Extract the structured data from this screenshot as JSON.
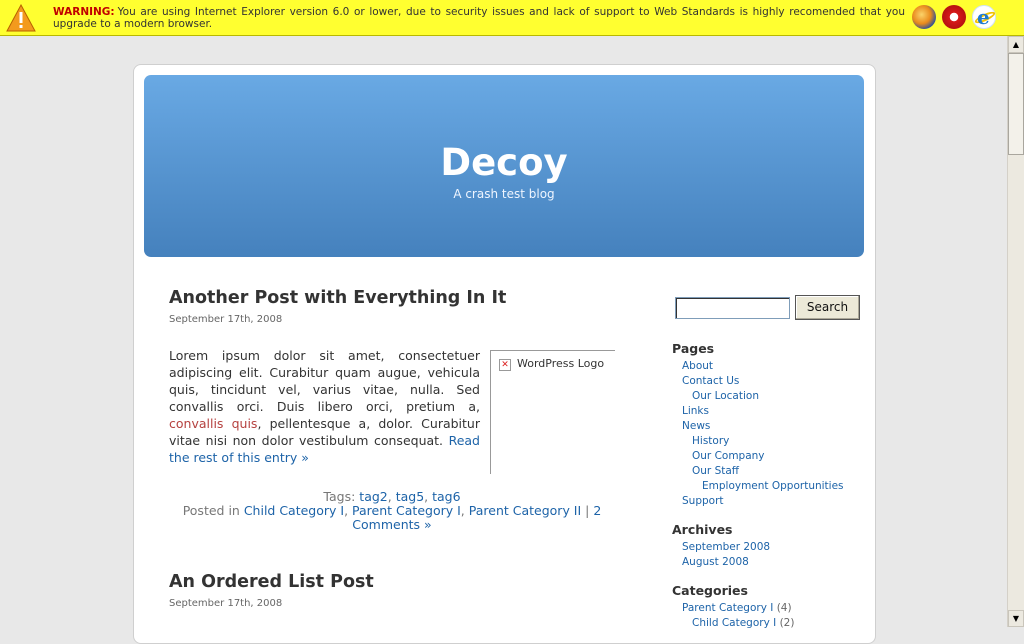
{
  "warning": {
    "label": "WARNING:",
    "message": "You are using Internet Explorer version 6.0 or lower, due to security issues and lack of support to Web Standards is highly recomended that you upgrade to a modern browser.",
    "icons": [
      "warning-icon",
      "firefox-icon",
      "opera-icon",
      "internet-explorer-icon"
    ]
  },
  "header": {
    "site_title": "Decoy",
    "tagline": "A crash test blog"
  },
  "posts": [
    {
      "title": "Another Post with Everything In It",
      "date": "September 17th, 2008",
      "body_text_1": "Lorem ipsum dolor sit amet, consectetuer adipiscing elit. Curabitur quam augue, vehicula quis, tincidunt vel, varius vitae, nulla. Sed convallis orci. Duis libero orci, pretium a, ",
      "body_link": "convallis quis",
      "body_text_2": ", pellentesque a, dolor. Curabitur vitae nisi non dolor vestibulum consequat. ",
      "read_more": "Read the rest of this entry »",
      "image_alt": "WordPress Logo",
      "tags_label": "Tags:",
      "tags": [
        "tag2",
        "tag5",
        "tag6"
      ],
      "posted_in_label": "Posted in",
      "categories": [
        "Child Category I",
        "Parent Category I",
        "Parent Category II"
      ],
      "comments": "2 Comments »"
    },
    {
      "title": "An Ordered List Post",
      "date": "September 17th, 2008"
    }
  ],
  "sidebar": {
    "search_button": "Search",
    "search_value": "",
    "pages_heading": "Pages",
    "pages": [
      {
        "label": "About",
        "level": 0
      },
      {
        "label": "Contact Us",
        "level": 0
      },
      {
        "label": "Our Location",
        "level": 1
      },
      {
        "label": "Links",
        "level": 0
      },
      {
        "label": "News",
        "level": 0
      },
      {
        "label": "History",
        "level": 1
      },
      {
        "label": "Our Company",
        "level": 1
      },
      {
        "label": "Our Staff",
        "level": 1
      },
      {
        "label": "Employment Opportunities",
        "level": 2
      },
      {
        "label": "Support",
        "level": 0
      }
    ],
    "archives_heading": "Archives",
    "archives": [
      "September 2008",
      "August 2008"
    ],
    "categories_heading": "Categories",
    "categories": [
      {
        "label": "Parent Category I",
        "count": "(4)",
        "level": 0
      },
      {
        "label": "Child Category I",
        "count": "(2)",
        "level": 1
      }
    ]
  },
  "colors": {
    "warning_bg": "#ffff30",
    "header_gradient_top": "#69a9e4",
    "header_gradient_bottom": "#4581bd",
    "link": "#1d63a8",
    "link_alt": "#b5413f"
  }
}
